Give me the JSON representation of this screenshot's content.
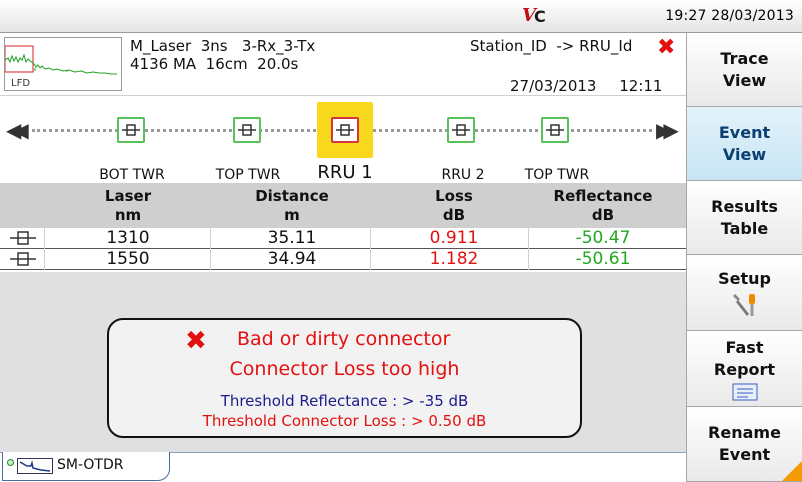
{
  "topbar": {
    "logo_text": "VC",
    "time": "19:27",
    "date": "28/03/2013"
  },
  "header": {
    "thumbnail_label": "LFD",
    "line1": "M_Laser  3ns   3-Rx_3-Tx",
    "line2": "4136 MA  16cm  20.0s",
    "station": "Station_ID  -> RRU_Id",
    "date": "27/03/2013",
    "time": "12:11"
  },
  "link_map": {
    "events": [
      {
        "label": "BOT TWR",
        "selected": false
      },
      {
        "label": "TOP TWR",
        "selected": false
      },
      {
        "label": "RRU 1",
        "selected": true
      },
      {
        "label": "RRU 2",
        "selected": false
      },
      {
        "label": "TOP TWR",
        "selected": false
      }
    ]
  },
  "table": {
    "columns": [
      {
        "name": "Laser",
        "unit": "nm"
      },
      {
        "name": "Distance",
        "unit": "m"
      },
      {
        "name": "Loss",
        "unit": "dB"
      },
      {
        "name": "Reflectance",
        "unit": "dB"
      }
    ],
    "rows": [
      {
        "laser": "1310",
        "distance": "35.11",
        "loss": "0.911",
        "reflectance": "-50.47"
      },
      {
        "laser": "1550",
        "distance": "34.94",
        "loss": "1.182",
        "reflectance": "-50.61"
      }
    ]
  },
  "diagnosis": {
    "line1": "Bad or dirty connector",
    "line2": "Connector Loss too high",
    "threshold_reflectance": "Threshold Reflectance : > -35 dB",
    "threshold_loss": "Threshold Connector Loss : > 0.50 dB"
  },
  "menu": {
    "trace_view": [
      "Trace",
      "View"
    ],
    "event_view": [
      "Event",
      "View"
    ],
    "results_table": [
      "Results",
      "Table"
    ],
    "setup": "Setup",
    "fast_report": [
      "Fast",
      "Report"
    ],
    "rename_event": [
      "Rename",
      "Event"
    ]
  },
  "tab": {
    "label": "SM-OTDR"
  },
  "colors": {
    "loss": "#e31010",
    "reflectance": "#22a722",
    "event_ok": "#58c258",
    "event_selected": "#d43838",
    "highlight": "#f7d81c",
    "active_menu": "#c6e4f4"
  }
}
